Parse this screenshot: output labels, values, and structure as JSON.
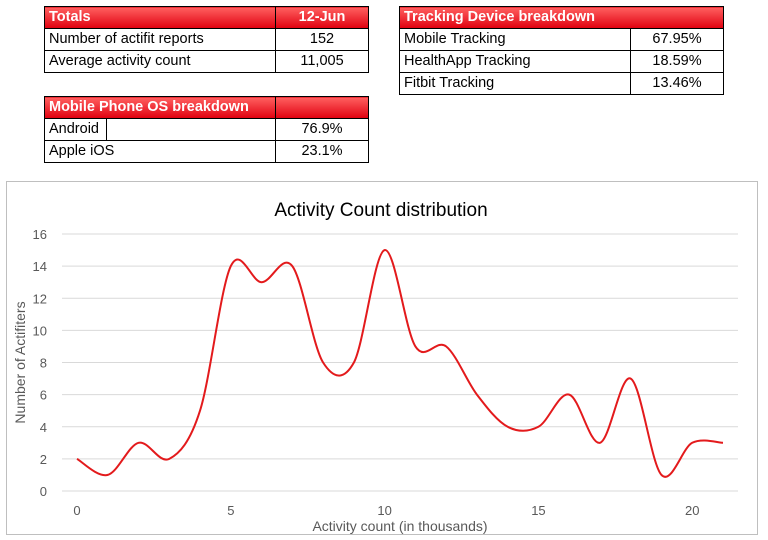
{
  "totals": {
    "header_label": "Totals",
    "header_date": "12-Jun",
    "rows": [
      {
        "label": "Number of actifit reports",
        "value": "152"
      },
      {
        "label": "Average activity count",
        "value": "11,005"
      }
    ]
  },
  "tracking": {
    "header_label": "Tracking Device breakdown",
    "rows": [
      {
        "label": "Mobile Tracking",
        "value": "67.95%"
      },
      {
        "label": "HealthApp Tracking",
        "value": "18.59%"
      },
      {
        "label": "Fitbit Tracking",
        "value": "13.46%"
      }
    ]
  },
  "os": {
    "header_label": "Mobile Phone OS breakdown",
    "rows": [
      {
        "label": "Android",
        "value": "76.9%"
      },
      {
        "label": "Apple iOS",
        "value": "23.1%"
      }
    ]
  },
  "colors": {
    "line": "#e31a1c",
    "header_red": "#e0000f",
    "grid": "#d9d9d9"
  },
  "chart_data": {
    "type": "line",
    "smooth": true,
    "title": "Activity Count distribution",
    "xlabel": "Activity count (in thousands)",
    "ylabel": "Number of Actifiters",
    "x": [
      0,
      1,
      2,
      3,
      4,
      5,
      6,
      7,
      8,
      9,
      10,
      11,
      12,
      13,
      14,
      15,
      16,
      17,
      18,
      19,
      20,
      21
    ],
    "series": [
      {
        "values": [
          2,
          1,
          3,
          2,
          5,
          14,
          13,
          14,
          8,
          8,
          15,
          9,
          9,
          6,
          4,
          4,
          6,
          3,
          7,
          1,
          3,
          3
        ]
      }
    ],
    "xlim": [
      0,
      21
    ],
    "ylim": [
      0,
      16
    ],
    "xticks": [
      0,
      5,
      10,
      15,
      20
    ],
    "yticks": [
      0,
      2,
      4,
      6,
      8,
      10,
      12,
      14,
      16
    ],
    "grid": true,
    "legend": "none"
  }
}
